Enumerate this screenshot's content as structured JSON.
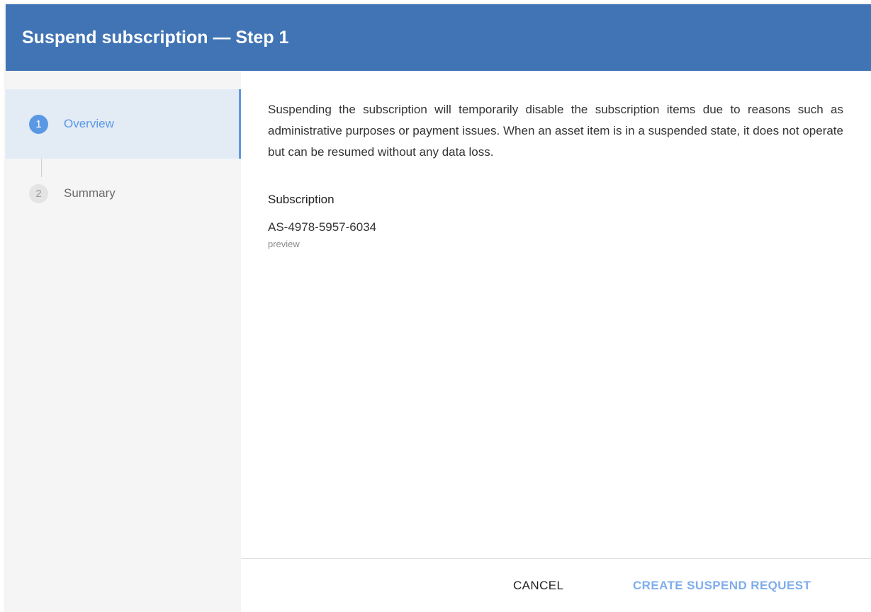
{
  "dialog": {
    "title": "Suspend subscription — Step 1"
  },
  "steps": [
    {
      "number": "1",
      "label": "Overview",
      "state": "active"
    },
    {
      "number": "2",
      "label": "Summary",
      "state": "inactive"
    }
  ],
  "content": {
    "description": "Suspending the subscription will temporarily disable the subscription items due to reasons such as administrative purposes or payment issues. When an asset item is in a suspended state, it does not operate but can be resumed without any data loss.",
    "subscription_label": "Subscription",
    "subscription_id": "AS-4978-5957-6034",
    "subscription_status": "preview"
  },
  "footer": {
    "cancel_label": "CANCEL",
    "create_label": "CREATE SUSPEND REQUEST"
  },
  "colors": {
    "header_bg": "#4174b4",
    "accent": "#5b98e4",
    "active_step_bg": "#e3ebf5",
    "primary_button_text": "#7fadeb"
  }
}
